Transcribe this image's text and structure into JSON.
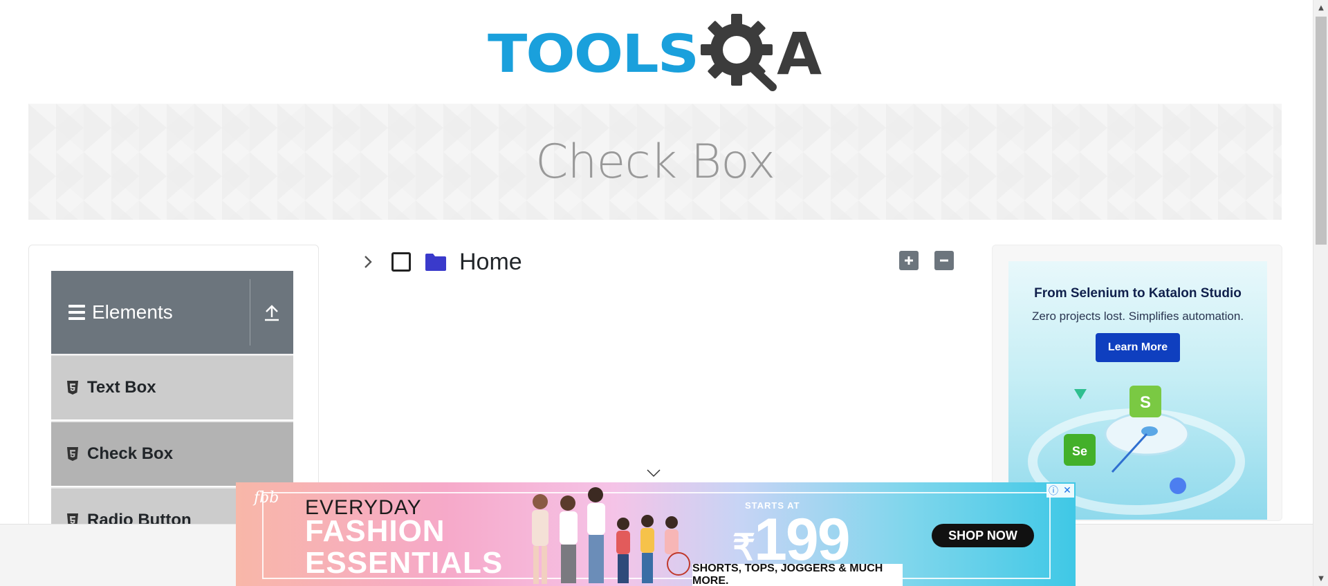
{
  "header": {
    "logo_text": "TOOLS",
    "logo_suffix": "A",
    "logo_icon": "gear-magnifier-icon"
  },
  "banner": {
    "title": "Check Box"
  },
  "sidebar": {
    "group": {
      "title": "Elements",
      "menu_icon": "hamburger-icon",
      "collapse_icon": "upload-arrow-icon"
    },
    "items": [
      {
        "label": "Text Box",
        "icon": "html5-icon",
        "active": false
      },
      {
        "label": "Check Box",
        "icon": "html5-icon",
        "active": true
      },
      {
        "label": "Radio Button",
        "icon": "html5-icon",
        "active": false
      }
    ]
  },
  "tree": {
    "root": {
      "label": "Home",
      "checked": false,
      "expanded": false,
      "toggle_icon": "chevron-right-icon",
      "folder_icon": "folder-icon"
    },
    "expand_all_icon": "plus-icon",
    "collapse_all_icon": "minus-icon"
  },
  "right_ad": {
    "title": "From Selenium to Katalon Studio",
    "subtitle": "Zero projects lost. Simplifies automation.",
    "button": "Learn More"
  },
  "bottom_ad": {
    "brand": "fbb",
    "line1": "EVERYDAY",
    "line2": "FASHION",
    "line3": "ESSENTIALS",
    "starts_at": "STARTS AT",
    "price": "199",
    "currency": "₹",
    "cta": "SHOP NOW",
    "tagline": "SHORTS, TOPS, JOGGERS & MUCH MORE.",
    "controls": {
      "info": "ⓘ",
      "close": "✕"
    }
  },
  "colors": {
    "logo_blue": "#1aa0dc",
    "logo_dark": "#3c3c3c",
    "sidebar_header": "#6c757d",
    "sidebar_item": "#cccccc",
    "sidebar_item_active": "#b3b3b3",
    "folder": "#3a3acb",
    "ad_button": "#0f3fbf"
  }
}
